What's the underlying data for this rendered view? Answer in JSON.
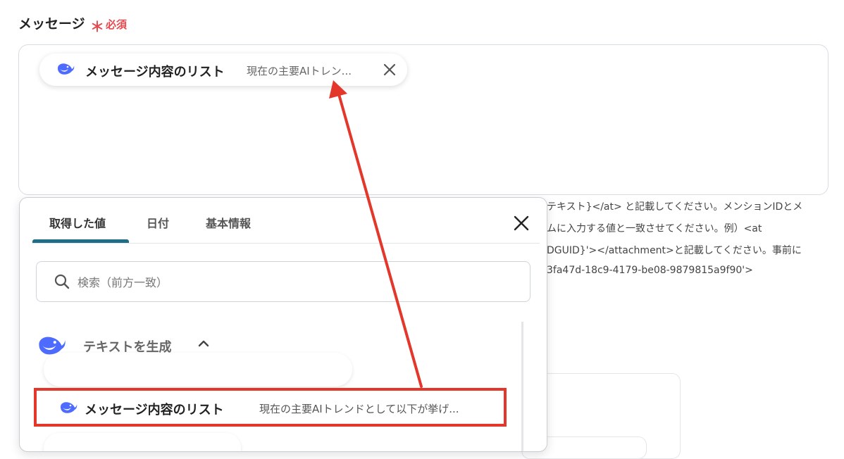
{
  "field": {
    "label": "メッセージ",
    "required_star": "＊",
    "required_text": "必須"
  },
  "chip": {
    "icon": "deepseek-whale-icon",
    "title": "メッセージ内容のリスト",
    "preview": "現在の主要AIトレン...",
    "close_icon": "close-icon"
  },
  "help_text": {
    "lines": [
      "テキスト}</at> と記載してください。メンションIDとメ",
      "ムに入力する値と一致させてください。例）<at",
      "DGUID}'></attachment>と記載してください。事前に",
      "3fa47d-18c9-4179-be08-9879815a9f90'>"
    ]
  },
  "dropdown": {
    "tabs": [
      {
        "label": "取得した値",
        "active": true
      },
      {
        "label": "日付",
        "active": false
      },
      {
        "label": "基本情報",
        "active": false
      }
    ],
    "search": {
      "placeholder": "検索（前方一致）",
      "value": ""
    },
    "group": {
      "title": "テキストを生成",
      "expanded": true
    },
    "items": [
      {
        "title": "メッセージ内容のリスト",
        "preview": "現在の主要AIトレンドとして以下が挙げ..."
      }
    ]
  },
  "colors": {
    "accent": "#1f6e86",
    "required": "#e5484d",
    "annotation_red": "#e3372b",
    "whale_blue": "#4d6bfe"
  }
}
